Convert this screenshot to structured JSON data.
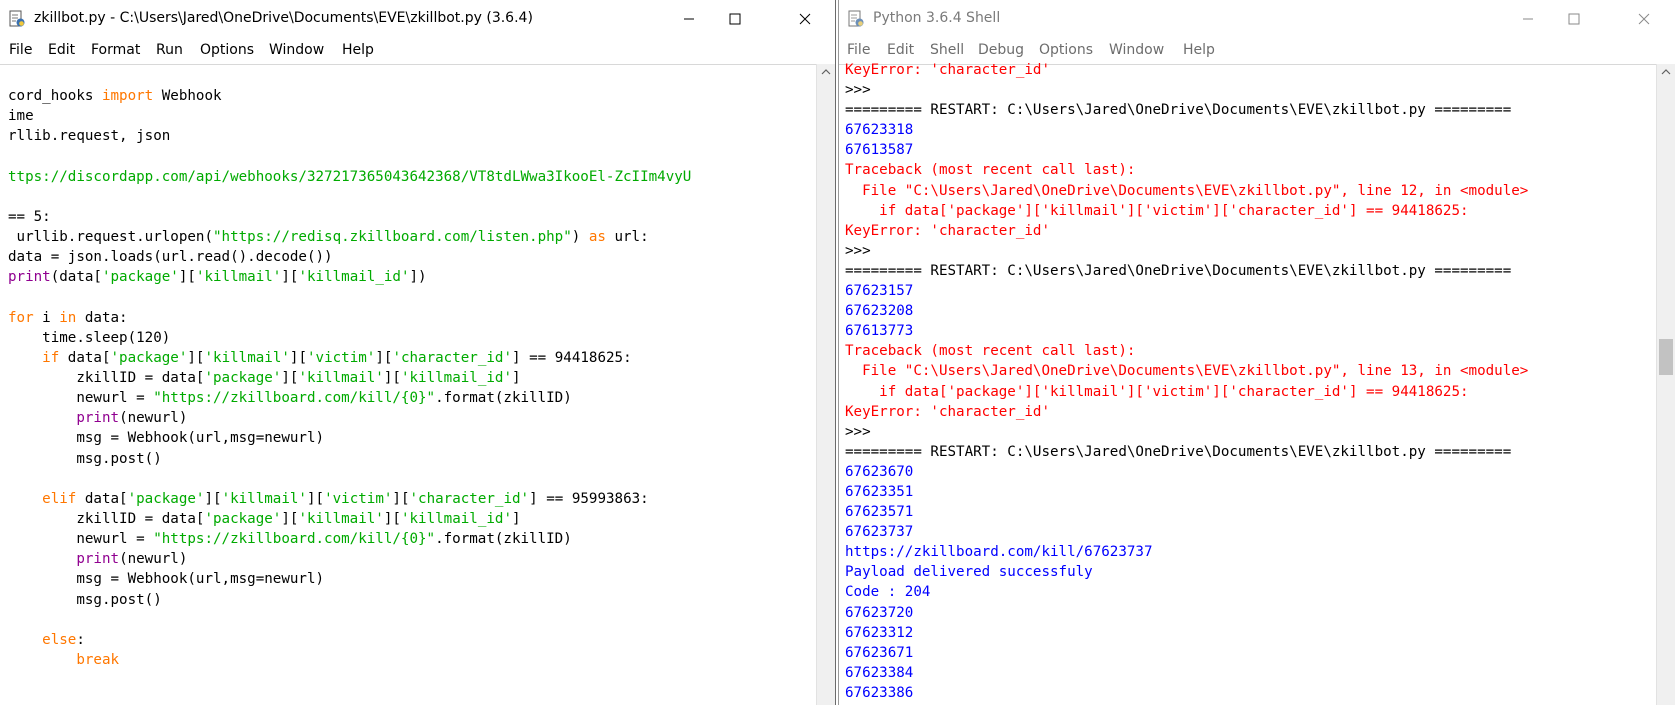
{
  "editor": {
    "title": "zkillbot.py - C:\\Users\\Jared\\OneDrive\\Documents\\EVE\\zkillbot.py (3.6.4)",
    "menu": [
      "File",
      "Edit",
      "Format",
      "Run",
      "Options",
      "Window",
      "Help"
    ],
    "lines": [
      [
        {
          "t": "cord_hooks ",
          "c": ""
        },
        {
          "t": "import",
          "c": "kw"
        },
        {
          "t": " Webhook",
          "c": ""
        }
      ],
      [
        {
          "t": "ime",
          "c": ""
        }
      ],
      [
        {
          "t": "rllib.request, json",
          "c": ""
        }
      ],
      [],
      [
        {
          "t": "ttps://discordapp.com/api/webhooks/327217365043642368/VT8tdLWwa3IkooEl-ZcIIm4vyU",
          "c": "st"
        }
      ],
      [],
      [
        {
          "t": "== 5:",
          "c": ""
        }
      ],
      [
        {
          "t": " urllib.request.urlopen(",
          "c": ""
        },
        {
          "t": "\"https://redisq.zkillboard.com/listen.php\"",
          "c": "st"
        },
        {
          "t": ") ",
          "c": ""
        },
        {
          "t": "as",
          "c": "kw"
        },
        {
          "t": " url:",
          "c": ""
        }
      ],
      [
        {
          "t": "data = json.loads(url.read().decode())",
          "c": ""
        }
      ],
      [
        {
          "t": "print",
          "c": "bi"
        },
        {
          "t": "(data[",
          "c": ""
        },
        {
          "t": "'package'",
          "c": "st"
        },
        {
          "t": "][",
          "c": ""
        },
        {
          "t": "'killmail'",
          "c": "st"
        },
        {
          "t": "][",
          "c": ""
        },
        {
          "t": "'killmail_id'",
          "c": "st"
        },
        {
          "t": "])",
          "c": ""
        }
      ],
      [],
      [
        {
          "t": "for",
          "c": "kw"
        },
        {
          "t": " i ",
          "c": ""
        },
        {
          "t": "in",
          "c": "kw"
        },
        {
          "t": " data:",
          "c": ""
        }
      ],
      [
        {
          "t": "    time.sleep(120)",
          "c": ""
        }
      ],
      [
        {
          "t": "    ",
          "c": ""
        },
        {
          "t": "if",
          "c": "kw"
        },
        {
          "t": " data[",
          "c": ""
        },
        {
          "t": "'package'",
          "c": "st"
        },
        {
          "t": "][",
          "c": ""
        },
        {
          "t": "'killmail'",
          "c": "st"
        },
        {
          "t": "][",
          "c": ""
        },
        {
          "t": "'victim'",
          "c": "st"
        },
        {
          "t": "][",
          "c": ""
        },
        {
          "t": "'character_id'",
          "c": "st"
        },
        {
          "t": "] == 94418625:",
          "c": ""
        }
      ],
      [
        {
          "t": "        zkillID = data[",
          "c": ""
        },
        {
          "t": "'package'",
          "c": "st"
        },
        {
          "t": "][",
          "c": ""
        },
        {
          "t": "'killmail'",
          "c": "st"
        },
        {
          "t": "][",
          "c": ""
        },
        {
          "t": "'killmail_id'",
          "c": "st"
        },
        {
          "t": "]",
          "c": ""
        }
      ],
      [
        {
          "t": "        newurl = ",
          "c": ""
        },
        {
          "t": "\"https://zkillboard.com/kill/{0}\"",
          "c": "st"
        },
        {
          "t": ".format(zkillID)",
          "c": ""
        }
      ],
      [
        {
          "t": "        ",
          "c": ""
        },
        {
          "t": "print",
          "c": "bi"
        },
        {
          "t": "(newurl)",
          "c": ""
        }
      ],
      [
        {
          "t": "        msg = Webhook(url,msg=newurl)",
          "c": ""
        }
      ],
      [
        {
          "t": "        msg.post()",
          "c": ""
        }
      ],
      [],
      [
        {
          "t": "    ",
          "c": ""
        },
        {
          "t": "elif",
          "c": "kw"
        },
        {
          "t": " data[",
          "c": ""
        },
        {
          "t": "'package'",
          "c": "st"
        },
        {
          "t": "][",
          "c": ""
        },
        {
          "t": "'killmail'",
          "c": "st"
        },
        {
          "t": "][",
          "c": ""
        },
        {
          "t": "'victim'",
          "c": "st"
        },
        {
          "t": "][",
          "c": ""
        },
        {
          "t": "'character_id'",
          "c": "st"
        },
        {
          "t": "] == 95993863:",
          "c": ""
        }
      ],
      [
        {
          "t": "        zkillID = data[",
          "c": ""
        },
        {
          "t": "'package'",
          "c": "st"
        },
        {
          "t": "][",
          "c": ""
        },
        {
          "t": "'killmail'",
          "c": "st"
        },
        {
          "t": "][",
          "c": ""
        },
        {
          "t": "'killmail_id'",
          "c": "st"
        },
        {
          "t": "]",
          "c": ""
        }
      ],
      [
        {
          "t": "        newurl = ",
          "c": ""
        },
        {
          "t": "\"https://zkillboard.com/kill/{0}\"",
          "c": "st"
        },
        {
          "t": ".format(zkillID)",
          "c": ""
        }
      ],
      [
        {
          "t": "        ",
          "c": ""
        },
        {
          "t": "print",
          "c": "bi"
        },
        {
          "t": "(newurl)",
          "c": ""
        }
      ],
      [
        {
          "t": "        msg = Webhook(url,msg=newurl)",
          "c": ""
        }
      ],
      [
        {
          "t": "        msg.post()",
          "c": ""
        }
      ],
      [],
      [
        {
          "t": "    ",
          "c": ""
        },
        {
          "t": "else",
          "c": "kw"
        },
        {
          "t": ":",
          "c": ""
        }
      ],
      [
        {
          "t": "        ",
          "c": ""
        },
        {
          "t": "break",
          "c": "kw"
        }
      ]
    ]
  },
  "shell": {
    "title": "Python 3.6.4 Shell",
    "menu": [
      "File",
      "Edit",
      "Shell",
      "Debug",
      "Options",
      "Window",
      "Help"
    ],
    "lines": [
      [
        {
          "t": "KeyError: 'character_id'",
          "c": "err"
        }
      ],
      [
        {
          "t": ">>>",
          "c": ""
        }
      ],
      [
        {
          "t": "========= RESTART: C:\\Users\\Jared\\OneDrive\\Documents\\EVE\\zkillbot.py =========",
          "c": ""
        }
      ],
      [
        {
          "t": "67623318",
          "c": "out"
        }
      ],
      [
        {
          "t": "67613587",
          "c": "out"
        }
      ],
      [
        {
          "t": "Traceback (most recent call last):",
          "c": "err"
        }
      ],
      [
        {
          "t": "  File \"C:\\Users\\Jared\\OneDrive\\Documents\\EVE\\zkillbot.py\", line 12, in <module>",
          "c": "err"
        }
      ],
      [
        {
          "t": "    if data['package']['killmail']['victim']['character_id'] == 94418625:",
          "c": "err"
        }
      ],
      [
        {
          "t": "KeyError: 'character_id'",
          "c": "err"
        }
      ],
      [
        {
          "t": ">>>",
          "c": ""
        }
      ],
      [
        {
          "t": "========= RESTART: C:\\Users\\Jared\\OneDrive\\Documents\\EVE\\zkillbot.py =========",
          "c": ""
        }
      ],
      [
        {
          "t": "67623157",
          "c": "out"
        }
      ],
      [
        {
          "t": "67623208",
          "c": "out"
        }
      ],
      [
        {
          "t": "67613773",
          "c": "out"
        }
      ],
      [
        {
          "t": "Traceback (most recent call last):",
          "c": "err"
        }
      ],
      [
        {
          "t": "  File \"C:\\Users\\Jared\\OneDrive\\Documents\\EVE\\zkillbot.py\", line 13, in <module>",
          "c": "err"
        }
      ],
      [
        {
          "t": "    if data['package']['killmail']['victim']['character_id'] == 94418625:",
          "c": "err"
        }
      ],
      [
        {
          "t": "KeyError: 'character_id'",
          "c": "err"
        }
      ],
      [
        {
          "t": ">>>",
          "c": ""
        }
      ],
      [
        {
          "t": "========= RESTART: C:\\Users\\Jared\\OneDrive\\Documents\\EVE\\zkillbot.py =========",
          "c": ""
        }
      ],
      [
        {
          "t": "67623670",
          "c": "out"
        }
      ],
      [
        {
          "t": "67623351",
          "c": "out"
        }
      ],
      [
        {
          "t": "67623571",
          "c": "out"
        }
      ],
      [
        {
          "t": "67623737",
          "c": "out"
        }
      ],
      [
        {
          "t": "https://zkillboard.com/kill/67623737",
          "c": "out"
        }
      ],
      [
        {
          "t": "Payload delivered successfuly",
          "c": "out"
        }
      ],
      [
        {
          "t": "Code : 204",
          "c": "out"
        }
      ],
      [
        {
          "t": "67623720",
          "c": "out"
        }
      ],
      [
        {
          "t": "67623312",
          "c": "out"
        }
      ],
      [
        {
          "t": "67623671",
          "c": "out"
        }
      ],
      [
        {
          "t": "67623384",
          "c": "out"
        }
      ],
      [
        {
          "t": "67623386",
          "c": "out"
        }
      ]
    ]
  }
}
